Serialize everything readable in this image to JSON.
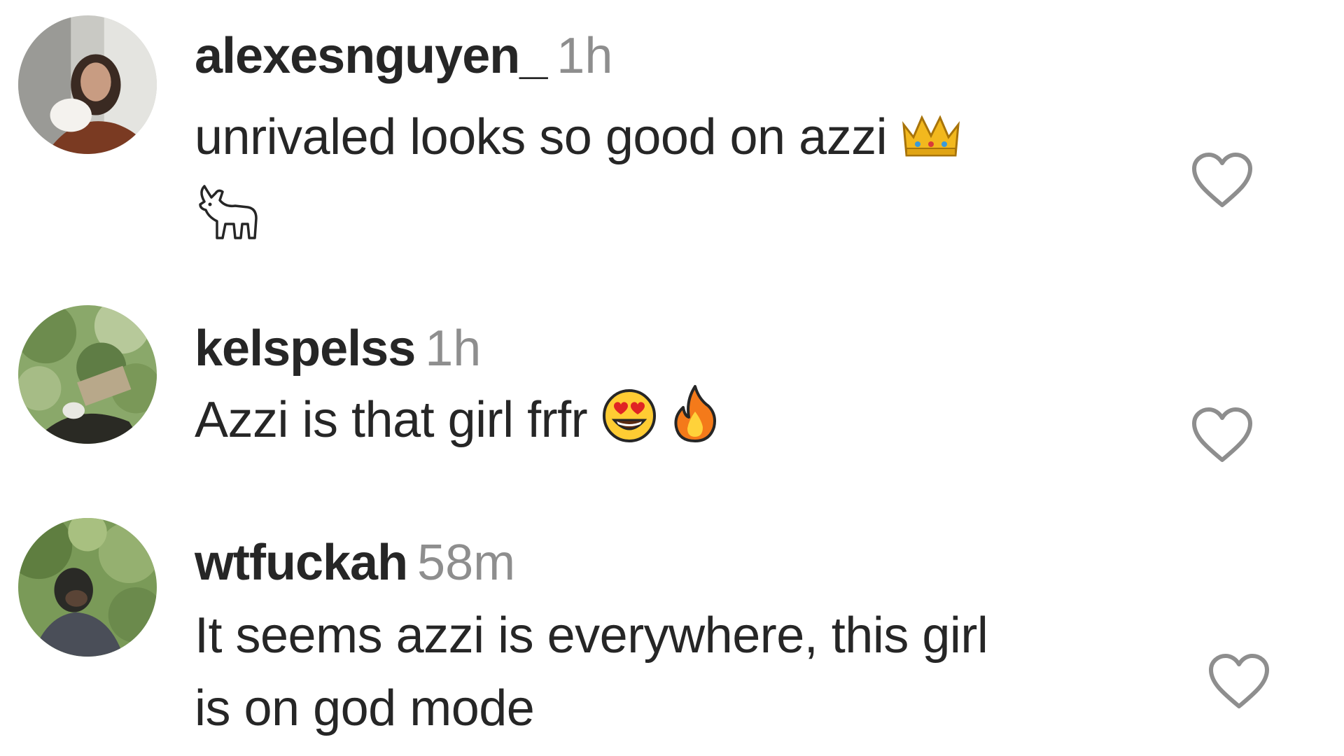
{
  "comments": [
    {
      "username": "alexesnguyen_",
      "time": "1h",
      "text": "unrivaled looks so good on azzi",
      "emojis": [
        "crown-emoji",
        "goat-emoji"
      ]
    },
    {
      "username": "kelspelss",
      "time": "1h",
      "text": "Azzi is that girl frfr",
      "emojis": [
        "heart-eyes-emoji",
        "fire-emoji"
      ]
    },
    {
      "username": "wtfuckah",
      "time": "58m",
      "text_line1": "It seems azzi is everywhere, this girl",
      "text_line2": "is on god mode"
    }
  ],
  "icons": {
    "like": "heart-outline-icon"
  },
  "colors": {
    "text": "#262626",
    "secondary": "#8e8e8e"
  }
}
